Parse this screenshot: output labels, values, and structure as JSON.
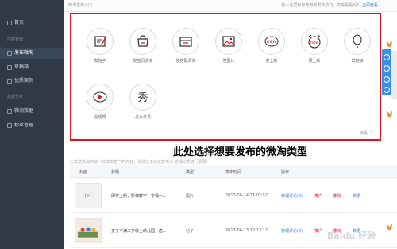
{
  "sidebar": {
    "items": [
      {
        "label": "首页",
        "active": false
      },
      {
        "label": "发布微淘",
        "active": true
      },
      {
        "label": "草稿箱",
        "active": false
      },
      {
        "label": "优质案例",
        "active": false
      },
      {
        "label": "微淘数据",
        "active": false
      },
      {
        "label": "粉丝管理",
        "active": false
      }
    ],
    "sections": [
      "内容管理",
      "数据分析"
    ]
  },
  "topbar": {
    "title": "微淘发布入口",
    "notice": "新—这里有你微淘的发布技巧，不来看看吗？",
    "notice_link": "立即查看"
  },
  "types": [
    {
      "label": "发帖子",
      "icon": "post-icon"
    },
    {
      "label": "发宝贝清单",
      "icon": "item-list-icon"
    },
    {
      "label": "发搭配清单",
      "icon": "outfit-list-icon"
    },
    {
      "label": "发图片",
      "icon": "image-icon"
    },
    {
      "label": "发上新",
      "icon": "new-arrival-icon"
    },
    {
      "label": "预上新",
      "icon": "pre-launch-icon"
    },
    {
      "label": "发链接",
      "icon": "link-icon"
    },
    {
      "label": "发视频",
      "icon": "video-icon"
    },
    {
      "label": "发买家秀",
      "icon": "buyer-show-icon"
    }
  ],
  "collapse_label": "收起",
  "annotation": "此处选择想要发布的微淘类型",
  "hint": "已发送微淘内容（非微淘生产的内容，请通过无线运营中心-店铺动态进行删除）",
  "table": {
    "headers": [
      "封面",
      "标题",
      "类型",
      "发布时间",
      "操作"
    ],
    "rows": [
      {
        "title": "即将上新，阶梯数字，字母一...",
        "type": "图片",
        "time": "2017-06-14 11:02:57",
        "action_manage": "管理评论(0)",
        "action_promote": "推广",
        "action_delete": "删除",
        "action_data": "数据"
      },
      {
        "title": "孩子不满三岁就上幼儿园，危...",
        "type": "帖子",
        "time": "2017-06-13 12:13:12",
        "action_manage": "管理评论(0)",
        "action_promote": "推广",
        "action_delete": "删除",
        "action_data": "数据"
      }
    ]
  },
  "watermark": "Baidu 经验",
  "colors": {
    "highlight": "#e0141c",
    "sidebar": "#2f3947",
    "link": "#3a7bd5",
    "float_bar": "#3a8ee6"
  }
}
